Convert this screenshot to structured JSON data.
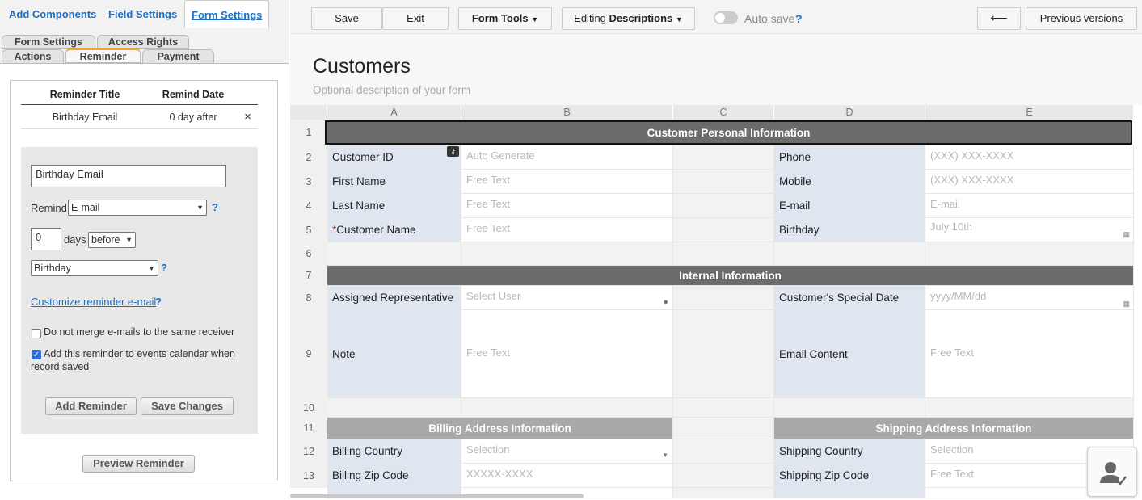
{
  "left_tabs": {
    "add_components": "Add Components",
    "field_settings": "Field Settings",
    "form_settings": "Form Settings"
  },
  "sub_tabs": {
    "form_settings": "Form Settings",
    "access_rights": "Access Rights",
    "actions": "Actions",
    "reminder": "Reminder",
    "payment": "Payment"
  },
  "reminder_table": {
    "col_title": "Reminder Title",
    "col_date": "Remind Date",
    "rows": [
      {
        "title": "Birthday Email",
        "date": "0 day after",
        "remove": "×"
      }
    ]
  },
  "editor": {
    "title_value": "Birthday Email",
    "remind_label": "Remind",
    "remind_select": "E-mail",
    "days_value": "0",
    "days_label": "days",
    "when_select": "before",
    "field_select": "Birthday",
    "help": "?",
    "customize_link": "Customize reminder e-mail",
    "no_merge_label": "Do not merge e-mails to the same receiver",
    "no_merge_checked": false,
    "calendar_label": "Add this reminder to events calendar when record saved",
    "calendar_checked": true,
    "add_button": "Add Reminder",
    "save_button": "Save Changes",
    "preview_button": "Preview Reminder"
  },
  "toolbar": {
    "save": "Save",
    "exit": "Exit",
    "form_tools": "Form Tools",
    "editing_prefix": "Editing ",
    "editing_bold": "Descriptions",
    "auto_save": "Auto save",
    "help": "?",
    "back_arrow": "⟵",
    "previous_versions": "Previous versions"
  },
  "form": {
    "title": "Customers",
    "description": "Optional description of your form"
  },
  "columns": [
    "A",
    "B",
    "C",
    "D",
    "E"
  ],
  "rows": {
    "r1": "1",
    "r2": "2",
    "r3": "3",
    "r4": "4",
    "r5": "5",
    "r6": "6",
    "r7": "7",
    "r8": "8",
    "r9": "9",
    "r10": "10",
    "r11": "11",
    "r12": "12",
    "r13": "13"
  },
  "sections": {
    "personal": "Customer Personal Information",
    "internal": "Internal Information",
    "billing": "Billing Address Information",
    "shipping": "Shipping Address Information"
  },
  "fields": {
    "customer_id": {
      "label": "Customer ID",
      "value": "Auto Generate"
    },
    "first_name": {
      "label": "First Name",
      "value": "Free Text"
    },
    "last_name": {
      "label": "Last Name",
      "value": "Free Text"
    },
    "customer_name": {
      "required": "*",
      "label": "Customer Name",
      "value": "Free Text"
    },
    "phone": {
      "label": "Phone",
      "value": "(XXX) XXX-XXXX"
    },
    "mobile": {
      "label": "Mobile",
      "value": "(XXX) XXX-XXXX"
    },
    "email": {
      "label": "E-mail",
      "value": "E-mail"
    },
    "birthday": {
      "label": "Birthday",
      "value": "July 10th"
    },
    "assigned_rep": {
      "label": "Assigned Representative",
      "value": "Select User"
    },
    "special_date": {
      "label": "Customer's Special Date",
      "value": "yyyy/MM/dd"
    },
    "note": {
      "label": "Note",
      "value": "Free Text"
    },
    "email_content": {
      "label": "Email Content",
      "value": "Free Text"
    },
    "billing_country": {
      "label": "Billing Country",
      "value": "Selection"
    },
    "billing_zip": {
      "label": "Billing Zip Code",
      "value": "XXXXX-XXXX"
    },
    "shipping_country": {
      "label": "Shipping Country",
      "value": "Selection"
    },
    "shipping_zip": {
      "label": "Shipping Zip Code",
      "value": "Free Text"
    }
  }
}
